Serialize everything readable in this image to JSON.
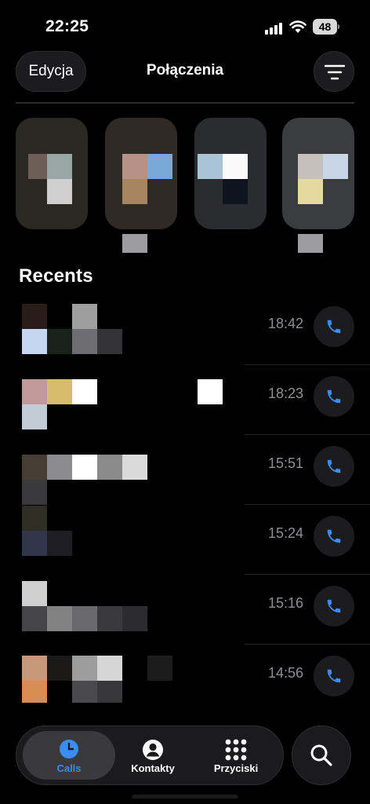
{
  "status_bar": {
    "time": "22:25",
    "battery": "48"
  },
  "header": {
    "edit_label": "Edycja",
    "title": "Połączenia"
  },
  "favorites": [
    {
      "name": "favorite-1",
      "bg": "#2a2a22"
    },
    {
      "name": "favorite-2",
      "bg": "#2f2a26"
    },
    {
      "name": "favorite-3",
      "bg": "#2a2c30"
    },
    {
      "name": "favorite-4",
      "bg": "#3a3c3e"
    }
  ],
  "recents_title": "Recents",
  "recents": [
    {
      "time": "18:42"
    },
    {
      "time": "18:23"
    },
    {
      "time": "15:51"
    },
    {
      "time": "15:24"
    },
    {
      "time": "15:16"
    },
    {
      "time": "14:56"
    }
  ],
  "tabs": [
    {
      "label": "Calls",
      "icon": "clock-icon",
      "active": true
    },
    {
      "label": "Kontakty",
      "icon": "person-icon",
      "active": false
    },
    {
      "label": "Przyciski",
      "icon": "keypad-icon",
      "active": false
    }
  ],
  "colors": {
    "accent": "#3b8cf5",
    "background": "#000000",
    "surface": "#1c1c1e",
    "secondary_text": "#8e8e93"
  }
}
